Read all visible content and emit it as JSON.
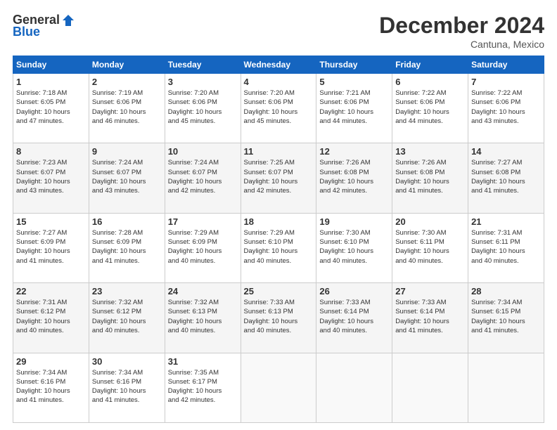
{
  "logo": {
    "general": "General",
    "blue": "Blue"
  },
  "title": "December 2024",
  "location": "Cantuna, Mexico",
  "days_of_week": [
    "Sunday",
    "Monday",
    "Tuesday",
    "Wednesday",
    "Thursday",
    "Friday",
    "Saturday"
  ],
  "weeks": [
    [
      {
        "day": "1",
        "sunrise": "7:18 AM",
        "sunset": "6:05 PM",
        "daylight": "10 hours and 47 minutes."
      },
      {
        "day": "2",
        "sunrise": "7:19 AM",
        "sunset": "6:06 PM",
        "daylight": "10 hours and 46 minutes."
      },
      {
        "day": "3",
        "sunrise": "7:20 AM",
        "sunset": "6:06 PM",
        "daylight": "10 hours and 45 minutes."
      },
      {
        "day": "4",
        "sunrise": "7:20 AM",
        "sunset": "6:06 PM",
        "daylight": "10 hours and 45 minutes."
      },
      {
        "day": "5",
        "sunrise": "7:21 AM",
        "sunset": "6:06 PM",
        "daylight": "10 hours and 44 minutes."
      },
      {
        "day": "6",
        "sunrise": "7:22 AM",
        "sunset": "6:06 PM",
        "daylight": "10 hours and 44 minutes."
      },
      {
        "day": "7",
        "sunrise": "7:22 AM",
        "sunset": "6:06 PM",
        "daylight": "10 hours and 43 minutes."
      }
    ],
    [
      {
        "day": "8",
        "sunrise": "7:23 AM",
        "sunset": "6:07 PM",
        "daylight": "10 hours and 43 minutes."
      },
      {
        "day": "9",
        "sunrise": "7:24 AM",
        "sunset": "6:07 PM",
        "daylight": "10 hours and 43 minutes."
      },
      {
        "day": "10",
        "sunrise": "7:24 AM",
        "sunset": "6:07 PM",
        "daylight": "10 hours and 42 minutes."
      },
      {
        "day": "11",
        "sunrise": "7:25 AM",
        "sunset": "6:07 PM",
        "daylight": "10 hours and 42 minutes."
      },
      {
        "day": "12",
        "sunrise": "7:26 AM",
        "sunset": "6:08 PM",
        "daylight": "10 hours and 42 minutes."
      },
      {
        "day": "13",
        "sunrise": "7:26 AM",
        "sunset": "6:08 PM",
        "daylight": "10 hours and 41 minutes."
      },
      {
        "day": "14",
        "sunrise": "7:27 AM",
        "sunset": "6:08 PM",
        "daylight": "10 hours and 41 minutes."
      }
    ],
    [
      {
        "day": "15",
        "sunrise": "7:27 AM",
        "sunset": "6:09 PM",
        "daylight": "10 hours and 41 minutes."
      },
      {
        "day": "16",
        "sunrise": "7:28 AM",
        "sunset": "6:09 PM",
        "daylight": "10 hours and 41 minutes."
      },
      {
        "day": "17",
        "sunrise": "7:29 AM",
        "sunset": "6:09 PM",
        "daylight": "10 hours and 40 minutes."
      },
      {
        "day": "18",
        "sunrise": "7:29 AM",
        "sunset": "6:10 PM",
        "daylight": "10 hours and 40 minutes."
      },
      {
        "day": "19",
        "sunrise": "7:30 AM",
        "sunset": "6:10 PM",
        "daylight": "10 hours and 40 minutes."
      },
      {
        "day": "20",
        "sunrise": "7:30 AM",
        "sunset": "6:11 PM",
        "daylight": "10 hours and 40 minutes."
      },
      {
        "day": "21",
        "sunrise": "7:31 AM",
        "sunset": "6:11 PM",
        "daylight": "10 hours and 40 minutes."
      }
    ],
    [
      {
        "day": "22",
        "sunrise": "7:31 AM",
        "sunset": "6:12 PM",
        "daylight": "10 hours and 40 minutes."
      },
      {
        "day": "23",
        "sunrise": "7:32 AM",
        "sunset": "6:12 PM",
        "daylight": "10 hours and 40 minutes."
      },
      {
        "day": "24",
        "sunrise": "7:32 AM",
        "sunset": "6:13 PM",
        "daylight": "10 hours and 40 minutes."
      },
      {
        "day": "25",
        "sunrise": "7:33 AM",
        "sunset": "6:13 PM",
        "daylight": "10 hours and 40 minutes."
      },
      {
        "day": "26",
        "sunrise": "7:33 AM",
        "sunset": "6:14 PM",
        "daylight": "10 hours and 40 minutes."
      },
      {
        "day": "27",
        "sunrise": "7:33 AM",
        "sunset": "6:14 PM",
        "daylight": "10 hours and 41 minutes."
      },
      {
        "day": "28",
        "sunrise": "7:34 AM",
        "sunset": "6:15 PM",
        "daylight": "10 hours and 41 minutes."
      }
    ],
    [
      {
        "day": "29",
        "sunrise": "7:34 AM",
        "sunset": "6:16 PM",
        "daylight": "10 hours and 41 minutes."
      },
      {
        "day": "30",
        "sunrise": "7:34 AM",
        "sunset": "6:16 PM",
        "daylight": "10 hours and 41 minutes."
      },
      {
        "day": "31",
        "sunrise": "7:35 AM",
        "sunset": "6:17 PM",
        "daylight": "10 hours and 42 minutes."
      },
      null,
      null,
      null,
      null
    ]
  ],
  "labels": {
    "sunrise": "Sunrise:",
    "sunset": "Sunset:",
    "daylight": "Daylight:"
  }
}
